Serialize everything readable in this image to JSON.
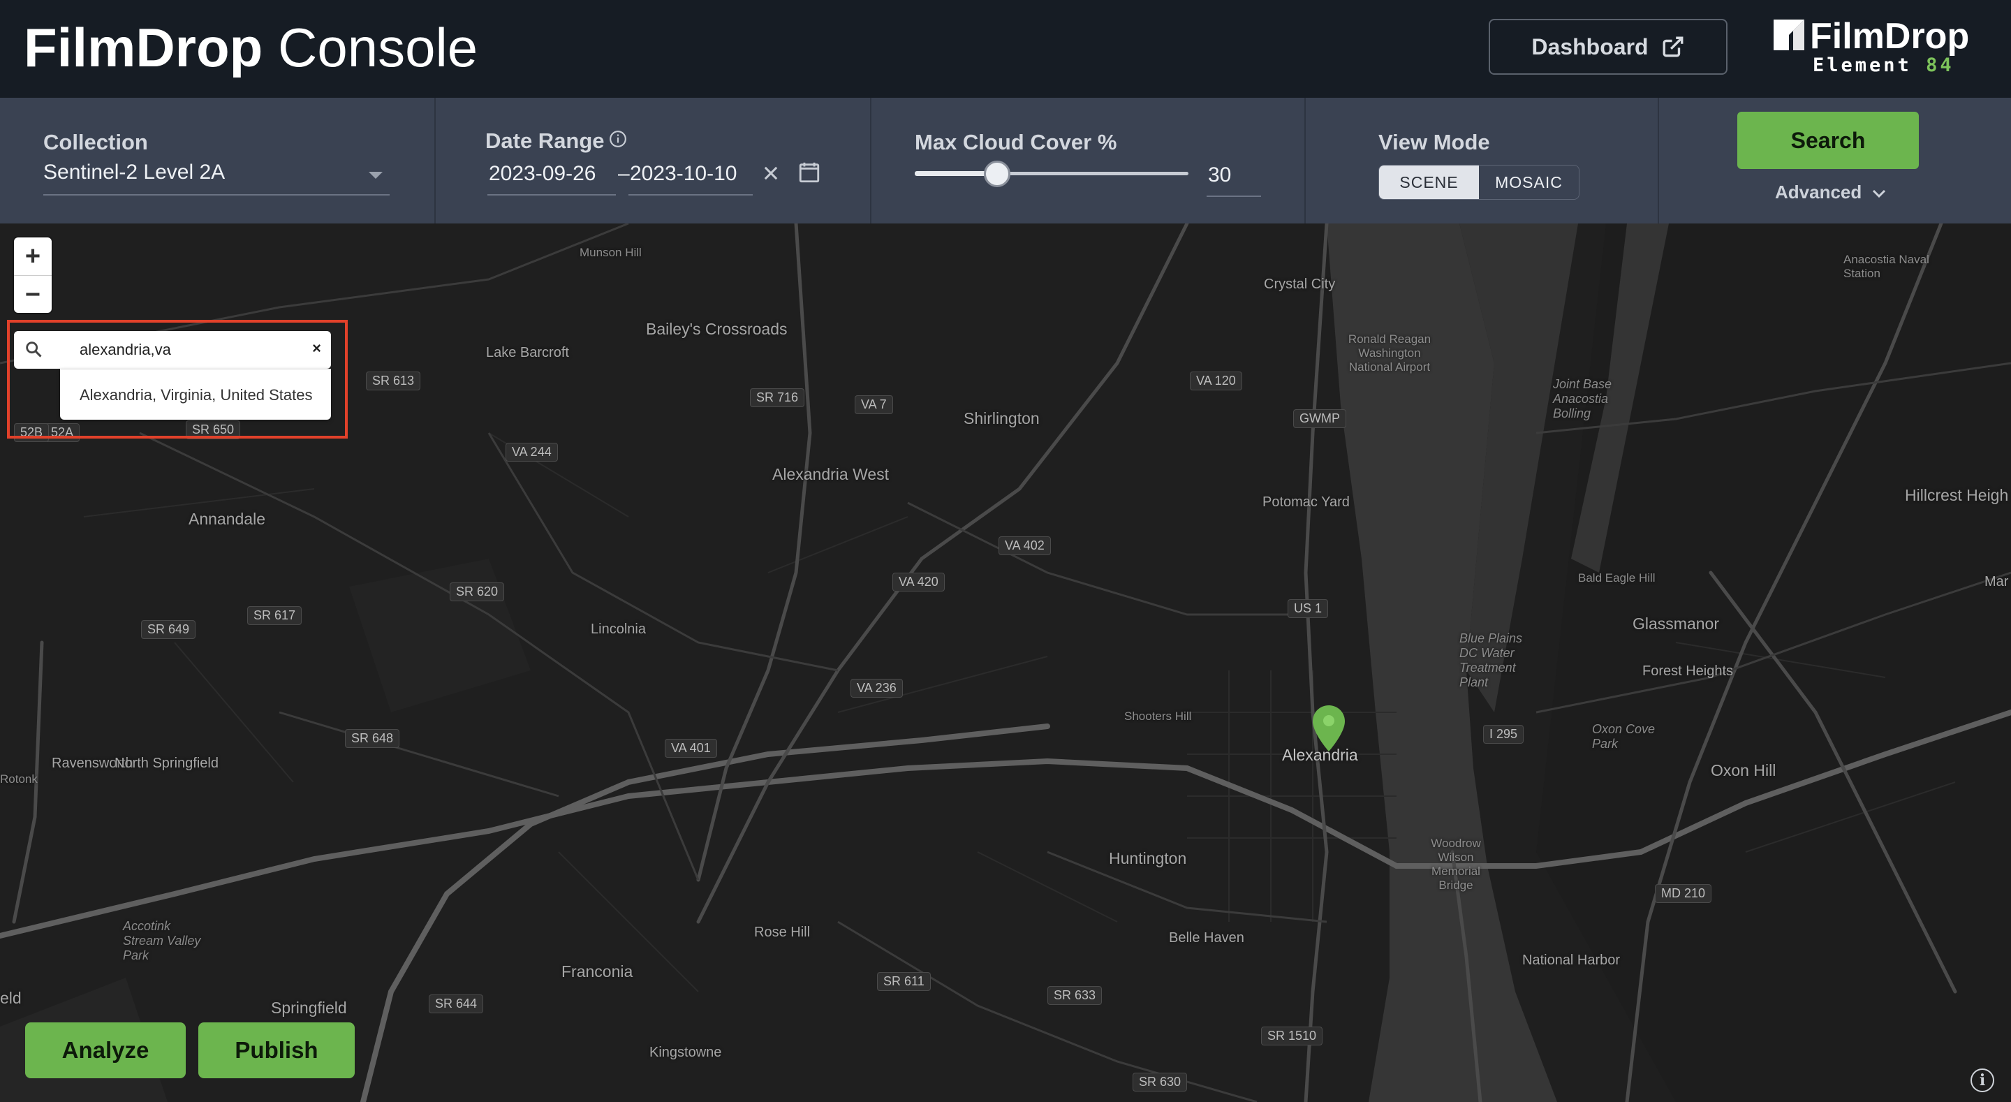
{
  "header": {
    "title_bold": "FilmDrop",
    "title_light": "Console",
    "dashboard_label": "Dashboard",
    "logo_name": "FilmDrop",
    "logo_sub": "Element",
    "logo_num": "84"
  },
  "filters": {
    "collection_label": "Collection",
    "collection_value": "Sentinel-2 Level 2A",
    "date_label": "Date Range",
    "date_start": "2023-09-26",
    "date_sep": "–",
    "date_end": "2023-10-10",
    "cloud_label": "Max Cloud Cover %",
    "cloud_value": "30",
    "cloud_fraction": 0.3,
    "viewmode_label": "View Mode",
    "viewmode_options": [
      "SCENE",
      "MOSAIC"
    ],
    "viewmode_selected": "SCENE",
    "search_label": "Search",
    "advanced_label": "Advanced"
  },
  "geocoder": {
    "query": "alexandria,va",
    "clear_glyph": "×",
    "suggestion": "Alexandria, Virginia, United States"
  },
  "zoom": {
    "in": "+",
    "out": "−"
  },
  "actions": {
    "analyze": "Analyze",
    "publish": "Publish"
  },
  "map": {
    "places": [
      "Bailey's Crossroads",
      "Lake Barcroft",
      "Shirlington",
      "Crystal City",
      "Annandale",
      "Alexandria West",
      "Lincolnia",
      "Potomac Yard",
      "Alexandria",
      "Ravensworth",
      "North Springfield",
      "Huntington",
      "Rose Hill",
      "Franconia",
      "Kingstowne",
      "Springfield",
      "Belle Haven",
      "Glassmanor",
      "Forest Heights",
      "Oxon Hill",
      "National Harbor",
      "Hillcrest Heigh",
      "Munson Hill",
      "Shooters Hill",
      "Woodrow Wilson Memorial Bridge",
      "Joint Base Anacostia Bolling",
      "Ronald Reagan Washington National Airport",
      "Accotink Stream Valley Park",
      "Blue Plains DC Water Treatment Plant",
      "Bald Eagle Hill",
      "Anacostia Naval Station",
      "Oxon Cove Park",
      "Rotonk",
      "eld",
      "Mar"
    ],
    "routes": [
      "SR 613",
      "SR 650",
      "VA 244",
      "SR 716",
      "VA 7",
      "VA 120",
      "GWMP",
      "VA 402",
      "VA 420",
      "SR 620",
      "SR 617",
      "SR 649",
      "VA 236",
      "VA 401",
      "SR 648",
      "US 1",
      "I 295",
      "SR 611",
      "SR 633",
      "SR 644",
      "SR 1510",
      "SR 630",
      "MD 210",
      "52A",
      "52B"
    ],
    "marker_color": "#6cb54e"
  },
  "colors": {
    "header_bg": "#161c24",
    "filter_bg": "#3a4252",
    "accent_green": "#6cb54e",
    "highlight_red": "#e1412a"
  },
  "icons": [
    "external-link-icon",
    "info-icon",
    "calendar-icon",
    "clear-icon",
    "chevron-down-icon",
    "search-icon",
    "map-pin-icon",
    "attribution-info-icon"
  ]
}
